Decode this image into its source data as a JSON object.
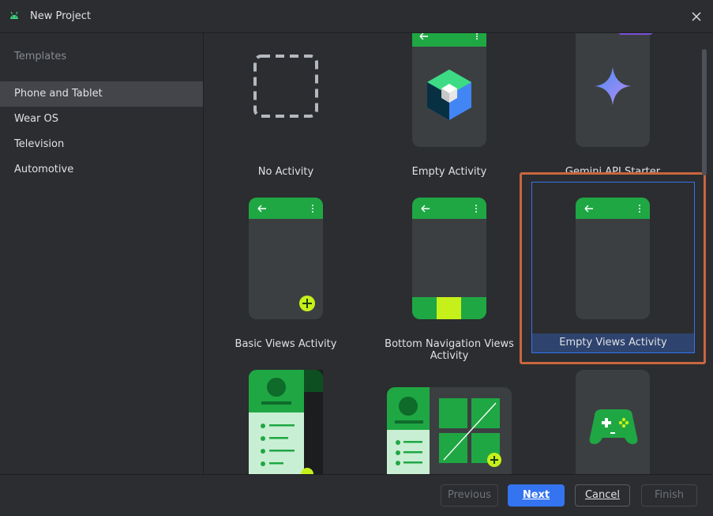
{
  "window": {
    "title": "New Project",
    "app_icon": "android-icon",
    "close_icon": "close-icon"
  },
  "sidebar": {
    "heading": "Templates",
    "items": [
      {
        "label": "Phone and Tablet",
        "selected": true
      },
      {
        "label": "Wear OS",
        "selected": false
      },
      {
        "label": "Television",
        "selected": false
      },
      {
        "label": "Automotive",
        "selected": false
      }
    ]
  },
  "templates": {
    "no_activity": "No Activity",
    "empty_activity": "Empty Activity",
    "gemini_api_starter": "Gemini API Starter",
    "basic_views_activity": "Basic Views Activity",
    "bottom_navigation_views_activity": "Bottom Navigation Views Activity",
    "empty_views_activity": "Empty Views Activity",
    "selected": "Empty Views Activity"
  },
  "footer": {
    "previous": "Previous",
    "next": "Next",
    "cancel": "Cancel",
    "finish": "Finish"
  },
  "colors": {
    "background": "#2b2d30",
    "android_green": "#1fa744",
    "accent_blue": "#3574f0",
    "selection_bg": "#2e436e",
    "highlight_outline": "#c8663f",
    "lime": "#c6f01a"
  }
}
